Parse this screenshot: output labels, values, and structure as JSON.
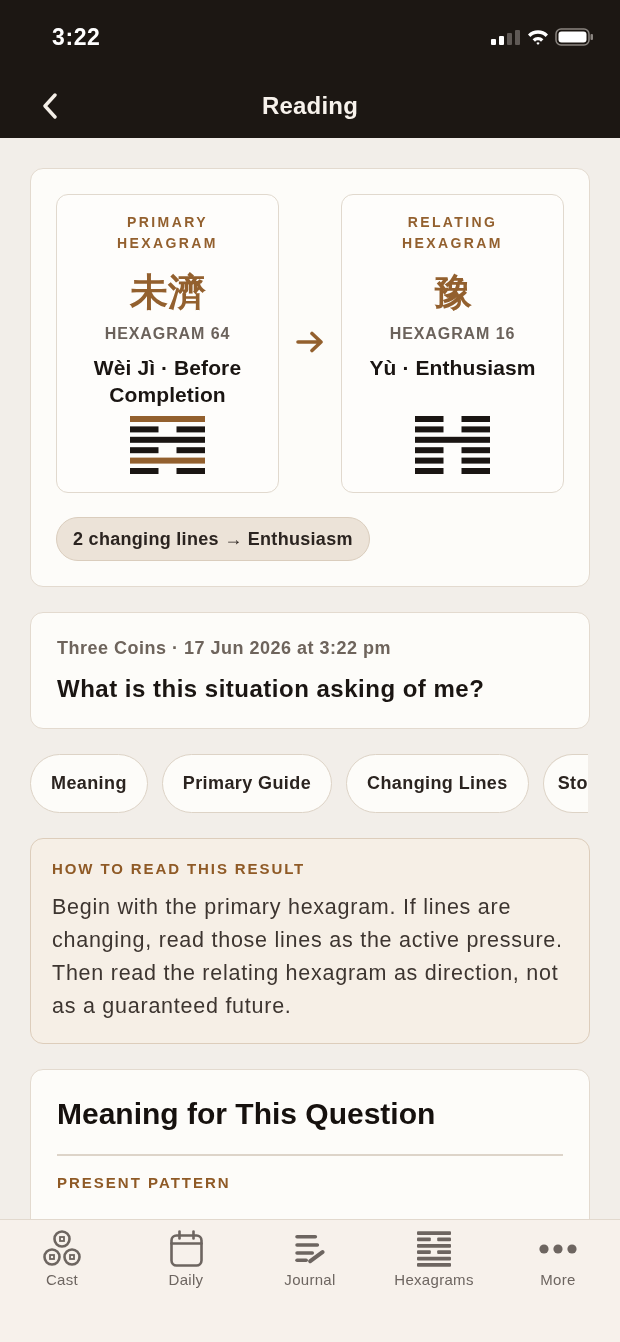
{
  "status_bar": {
    "time": "3:22"
  },
  "nav_bar": {
    "title": "Reading"
  },
  "hexagrams": [
    {
      "role": "PRIMARY HEXAGRAM",
      "character": "未濟",
      "number": "HEXAGRAM 64",
      "name": "Wèi Jì · Before Completion",
      "lines": [
        {
          "kind": "solid",
          "changing": true
        },
        {
          "kind": "broken",
          "changing": false
        },
        {
          "kind": "solid",
          "changing": false
        },
        {
          "kind": "broken",
          "changing": false
        },
        {
          "kind": "solid",
          "changing": true
        },
        {
          "kind": "broken",
          "changing": false
        }
      ]
    },
    {
      "role": "RELATING HEXAGRAM",
      "character": "豫",
      "number": "HEXAGRAM 16",
      "name": "Yù · Enthusiasm",
      "lines": [
        {
          "kind": "broken",
          "changing": false
        },
        {
          "kind": "broken",
          "changing": false
        },
        {
          "kind": "solid",
          "changing": false
        },
        {
          "kind": "broken",
          "changing": false
        },
        {
          "kind": "broken",
          "changing": false
        },
        {
          "kind": "broken",
          "changing": false
        }
      ]
    }
  ],
  "changing_summary": "2 changing lines → Enthusiasm",
  "question_card": {
    "meta": "Three Coins · 17 Jun 2026 at 3:22 pm",
    "question": "What is this situation asking of me?"
  },
  "section_tabs": [
    {
      "label": "Meaning",
      "selected": false
    },
    {
      "label": "Primary Guide",
      "selected": false
    },
    {
      "label": "Changing Lines",
      "selected": false
    },
    {
      "label": "Sto",
      "selected": false
    }
  ],
  "guide": {
    "title": "HOW TO READ THIS RESULT",
    "body": "Begin with the primary hexagram. If lines are changing, read those lines as the active pressure. Then read the relating hexagram as direction, not as a guaranteed future."
  },
  "meaning": {
    "title": "Meaning for This Question",
    "section_label": "PRESENT PATTERN"
  },
  "tab_bar": [
    {
      "label": "Cast",
      "selected": false
    },
    {
      "label": "Daily",
      "selected": false
    },
    {
      "label": "Journal",
      "selected": false
    },
    {
      "label": "Hexagrams",
      "selected": false
    },
    {
      "label": "More",
      "selected": false
    }
  ]
}
